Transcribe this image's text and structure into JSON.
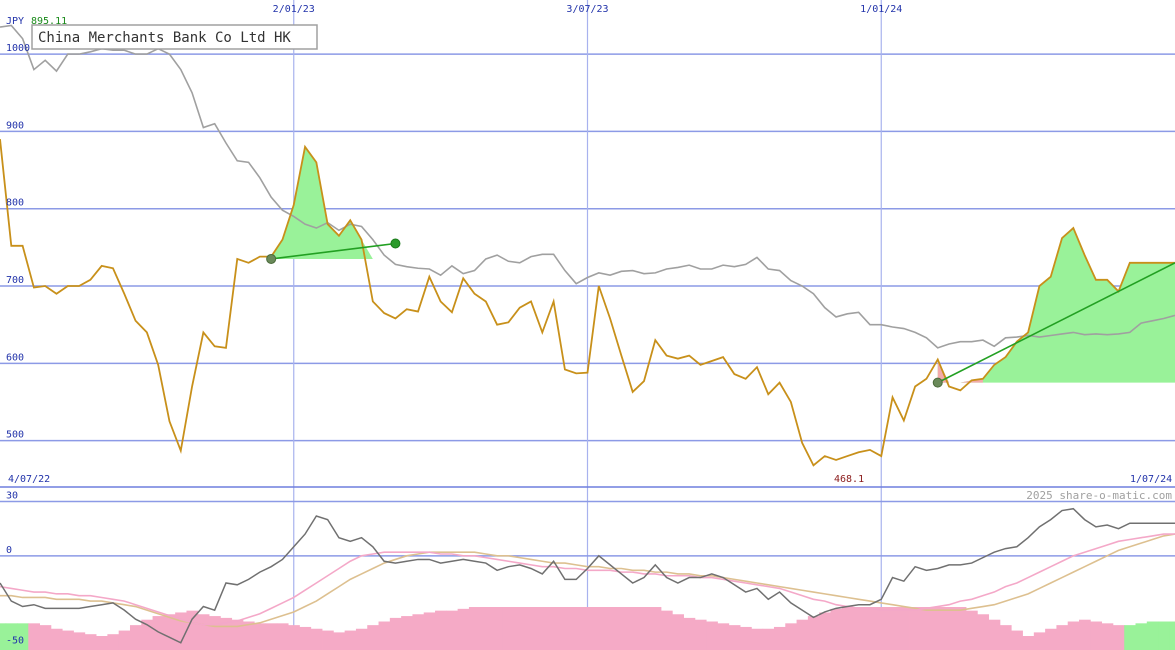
{
  "chart_data": [
    {
      "type": "line",
      "title": "China Merchants Bank Co Ltd HK",
      "currency_label": "JPY",
      "last_value_label": "895.11",
      "min_value_label": "468.1",
      "ylim": [
        440,
        1070
      ],
      "y_ticks": [
        1000,
        900,
        800,
        700,
        600,
        500
      ],
      "grid": true,
      "x_date_range": [
        "2022-07-04",
        "2024-07-01"
      ],
      "x_top_labels": [
        {
          "date": "2023-01-02",
          "label": "2/01/23"
        },
        {
          "date": "2023-07-03",
          "label": "3/07/23"
        },
        {
          "date": "2024-01-01",
          "label": "1/01/24"
        }
      ],
      "x_bottom_labels": {
        "start": "4/07/22",
        "end": "1/07/24"
      },
      "series": [
        {
          "name": "",
          "color": "#c8901a",
          "x": [
            "2022-07-04",
            "2022-07-11",
            "2022-07-18",
            "2022-07-25",
            "2022-08-01",
            "2022-08-08",
            "2022-08-15",
            "2022-08-22",
            "2022-08-29",
            "2022-09-05",
            "2022-09-12",
            "2022-09-19",
            "2022-09-26",
            "2022-10-03",
            "2022-10-10",
            "2022-10-17",
            "2022-10-24",
            "2022-10-31",
            "2022-11-07",
            "2022-11-14",
            "2022-11-21",
            "2022-11-28",
            "2022-12-05",
            "2022-12-12",
            "2022-12-19",
            "2022-12-26",
            "2023-01-02",
            "2023-01-09",
            "2023-01-16",
            "2023-01-23",
            "2023-01-30",
            "2023-02-06",
            "2023-02-13",
            "2023-02-20",
            "2023-02-27",
            "2023-03-06",
            "2023-03-13",
            "2023-03-20",
            "2023-03-27",
            "2023-04-03",
            "2023-04-10",
            "2023-04-17",
            "2023-04-24",
            "2023-05-01",
            "2023-05-08",
            "2023-05-15",
            "2023-05-22",
            "2023-05-29",
            "2023-06-05",
            "2023-06-12",
            "2023-06-19",
            "2023-06-26",
            "2023-07-03",
            "2023-07-10",
            "2023-07-17",
            "2023-07-24",
            "2023-07-31",
            "2023-08-07",
            "2023-08-14",
            "2023-08-21",
            "2023-08-28",
            "2023-09-04",
            "2023-09-11",
            "2023-09-18",
            "2023-09-25",
            "2023-10-02",
            "2023-10-09",
            "2023-10-16",
            "2023-10-23",
            "2023-10-30",
            "2023-11-06",
            "2023-11-13",
            "2023-11-20",
            "2023-11-27",
            "2023-12-04",
            "2023-12-11",
            "2023-12-18",
            "2023-12-25",
            "2024-01-01",
            "2024-01-08",
            "2024-01-15",
            "2024-01-22",
            "2024-01-29",
            "2024-02-05",
            "2024-02-12",
            "2024-02-19",
            "2024-02-26",
            "2024-03-04",
            "2024-03-11",
            "2024-03-18",
            "2024-03-25",
            "2024-04-01",
            "2024-04-08",
            "2024-04-15",
            "2024-04-22",
            "2024-04-29",
            "2024-05-06",
            "2024-05-13",
            "2024-05-20",
            "2024-05-27",
            "2024-06-03",
            "2024-06-10",
            "2024-06-17",
            "2024-06-24",
            "2024-07-01"
          ],
          "values": [
            890,
            752,
            752,
            698,
            700,
            690,
            700,
            700,
            708,
            726,
            723,
            690,
            655,
            640,
            598,
            525,
            487,
            570,
            640,
            622,
            620,
            735,
            730,
            738,
            738,
            760,
            805,
            880,
            860,
            780,
            765,
            785,
            760,
            680,
            665,
            658,
            670,
            667,
            712,
            680,
            666,
            710,
            690,
            680,
            650,
            653,
            672,
            680,
            640,
            680,
            592,
            587,
            588,
            700,
            658,
            610,
            563,
            577,
            630,
            610,
            606,
            610,
            598,
            603,
            608,
            586,
            580,
            595,
            560,
            575,
            550,
            497,
            468,
            480,
            475,
            480,
            485,
            488,
            480,
            556,
            526,
            570,
            580,
            605,
            570,
            565,
            578,
            580,
            598,
            608,
            628,
            640,
            700,
            712,
            762,
            775,
            740,
            708,
            708,
            693,
            730,
            730,
            730,
            730,
            730
          ]
        },
        {
          "name": "",
          "color": "#a0a0a0",
          "x": [
            "2022-07-04",
            "2022-07-11",
            "2022-07-18",
            "2022-07-25",
            "2022-08-01",
            "2022-08-08",
            "2022-08-15",
            "2022-08-22",
            "2022-08-29",
            "2022-09-05",
            "2022-09-12",
            "2022-09-19",
            "2022-09-26",
            "2022-10-03",
            "2022-10-10",
            "2022-10-17",
            "2022-10-24",
            "2022-10-31",
            "2022-11-07",
            "2022-11-14",
            "2022-11-21",
            "2022-11-28",
            "2022-12-05",
            "2022-12-12",
            "2022-12-19",
            "2022-12-26",
            "2023-01-02",
            "2023-01-09",
            "2023-01-16",
            "2023-01-23",
            "2023-01-30",
            "2023-02-06",
            "2023-02-13",
            "2023-02-20",
            "2023-02-27",
            "2023-03-06",
            "2023-03-13",
            "2023-03-20",
            "2023-03-27",
            "2023-04-03",
            "2023-04-10",
            "2023-04-17",
            "2023-04-24",
            "2023-05-01",
            "2023-05-08",
            "2023-05-15",
            "2023-05-22",
            "2023-05-29",
            "2023-06-05",
            "2023-06-12",
            "2023-06-19",
            "2023-06-26",
            "2023-07-03",
            "2023-07-10",
            "2023-07-17",
            "2023-07-24",
            "2023-07-31",
            "2023-08-07",
            "2023-08-14",
            "2023-08-21",
            "2023-08-28",
            "2023-09-04",
            "2023-09-11",
            "2023-09-18",
            "2023-09-25",
            "2023-10-02",
            "2023-10-09",
            "2023-10-16",
            "2023-10-23",
            "2023-10-30",
            "2023-11-06",
            "2023-11-13",
            "2023-11-20",
            "2023-11-27",
            "2023-12-04",
            "2023-12-11",
            "2023-12-18",
            "2023-12-25",
            "2024-01-01",
            "2024-01-08",
            "2024-01-15",
            "2024-01-22",
            "2024-01-29",
            "2024-02-05",
            "2024-02-12",
            "2024-02-19",
            "2024-02-26",
            "2024-03-04",
            "2024-03-11",
            "2024-03-18",
            "2024-03-25",
            "2024-04-01",
            "2024-04-08",
            "2024-04-15",
            "2024-04-22",
            "2024-04-29",
            "2024-05-06",
            "2024-05-13",
            "2024-05-20",
            "2024-05-27",
            "2024-06-03",
            "2024-06-10",
            "2024-06-17",
            "2024-06-24",
            "2024-07-01"
          ],
          "values": [
            1035,
            1037,
            1020,
            980,
            992,
            978,
            1000,
            1000,
            1003,
            1007,
            1005,
            1005,
            1000,
            1000,
            1007,
            1000,
            980,
            950,
            905,
            910,
            885,
            862,
            860,
            840,
            815,
            798,
            790,
            780,
            775,
            782,
            772,
            780,
            777,
            760,
            740,
            728,
            725,
            723,
            722,
            714,
            726,
            716,
            720,
            735,
            740,
            732,
            730,
            738,
            741,
            741,
            720,
            703,
            711,
            717,
            714,
            719,
            720,
            716,
            717,
            722,
            724,
            727,
            722,
            722,
            727,
            725,
            728,
            737,
            722,
            720,
            707,
            700,
            690,
            672,
            660,
            664,
            666,
            650,
            650,
            647,
            645,
            640,
            633,
            620,
            625,
            628,
            628,
            630,
            622,
            633,
            634,
            636,
            634,
            636,
            638,
            640,
            637,
            638,
            637,
            638,
            640,
            652,
            655,
            658,
            662
          ]
        }
      ],
      "highlight_regions": [
        {
          "color": "#99f299",
          "from": "2022-12-19",
          "to": "2023-03-06"
        },
        {
          "color": "#99f299",
          "from": "2024-02-05",
          "to": "2024-07-01"
        },
        {
          "color": "#f2aaaa",
          "from": "2024-02-05",
          "to": "2024-03-04"
        }
      ],
      "trend_lines": [
        {
          "color": "#22a022",
          "from": {
            "x": "2022-12-19",
            "y": 735
          },
          "to": {
            "x": "2023-03-06",
            "y": 755
          }
        },
        {
          "color": "#22a022",
          "from": {
            "x": "2024-02-05",
            "y": 575
          },
          "to": {
            "x": "2024-07-01",
            "y": 730
          }
        }
      ],
      "credit": "2025 share-o-matic.com"
    },
    {
      "type": "line",
      "ylim": [
        -52,
        38
      ],
      "y_ticks": [
        30,
        0,
        -50
      ],
      "grid": true,
      "series": [
        {
          "name": "",
          "color": "#707070",
          "values": [
            -15,
            -25,
            -28,
            -27,
            -29,
            -29,
            -29,
            -29,
            -28,
            -27,
            -26,
            -30,
            -35,
            -38,
            -42,
            -45,
            -48,
            -35,
            -28,
            -30,
            -15,
            -16,
            -13,
            -9,
            -6,
            -2,
            5,
            12,
            22,
            20,
            10,
            8,
            10,
            5,
            -3,
            -4,
            -3,
            -2,
            -2,
            -4,
            -3,
            -2,
            -3,
            -4,
            -8,
            -6,
            -5,
            -7,
            -10,
            -3,
            -13,
            -13,
            -7,
            0,
            -5,
            -10,
            -15,
            -12,
            -5,
            -12,
            -15,
            -12,
            -12,
            -10,
            -12,
            -16,
            -20,
            -18,
            -24,
            -20,
            -26,
            -30,
            -34,
            -31,
            -29,
            -28,
            -27,
            -27,
            -24,
            -12,
            -14,
            -6,
            -8,
            -7,
            -5,
            -5,
            -4,
            -1,
            2,
            4,
            5,
            10,
            16,
            20,
            25,
            26,
            20,
            16,
            17,
            15,
            18,
            18,
            18,
            18,
            18
          ]
        },
        {
          "name": "",
          "color": "#f4a8c8",
          "values": [
            -17,
            -18,
            -19,
            -20,
            -20,
            -21,
            -21,
            -22,
            -22,
            -23,
            -24,
            -25,
            -27,
            -29,
            -31,
            -33,
            -35,
            -37,
            -38,
            -38,
            -37,
            -36,
            -34,
            -32,
            -29,
            -26,
            -23,
            -19,
            -15,
            -11,
            -7,
            -3,
            0,
            1,
            2,
            2,
            2,
            2,
            2,
            1,
            1,
            0,
            0,
            -1,
            -2,
            -3,
            -4,
            -5,
            -6,
            -6,
            -7,
            -7,
            -8,
            -8,
            -8,
            -9,
            -9,
            -10,
            -10,
            -11,
            -11,
            -11,
            -12,
            -12,
            -13,
            -14,
            -15,
            -16,
            -17,
            -18,
            -20,
            -22,
            -24,
            -25,
            -27,
            -28,
            -29,
            -29,
            -30,
            -30,
            -30,
            -30,
            -29,
            -28,
            -27,
            -25,
            -24,
            -22,
            -20,
            -17,
            -15,
            -12,
            -9,
            -6,
            -3,
            0,
            2,
            4,
            6,
            8,
            9,
            10,
            11,
            12,
            12
          ]
        },
        {
          "name": "",
          "color": "#ddc090",
          "values": [
            -22,
            -22,
            -23,
            -23,
            -23,
            -24,
            -24,
            -24,
            -25,
            -25,
            -26,
            -27,
            -28,
            -30,
            -32,
            -34,
            -36,
            -37,
            -38,
            -39,
            -39,
            -39,
            -38,
            -37,
            -35,
            -33,
            -31,
            -28,
            -25,
            -21,
            -17,
            -13,
            -10,
            -7,
            -4,
            -2,
            0,
            1,
            2,
            2,
            2,
            2,
            2,
            1,
            0,
            0,
            -1,
            -2,
            -3,
            -4,
            -4,
            -5,
            -6,
            -6,
            -7,
            -7,
            -8,
            -8,
            -9,
            -9,
            -10,
            -10,
            -11,
            -11,
            -12,
            -13,
            -14,
            -15,
            -16,
            -17,
            -18,
            -19,
            -20,
            -21,
            -22,
            -23,
            -24,
            -25,
            -26,
            -27,
            -28,
            -29,
            -30,
            -30,
            -30,
            -30,
            -29,
            -28,
            -27,
            -25,
            -23,
            -21,
            -18,
            -15,
            -12,
            -9,
            -6,
            -3,
            0,
            3,
            5,
            7,
            9,
            11,
            12
          ]
        },
        {
          "name": "",
          "type": "bar",
          "color": "#f5aac6",
          "values": [
            -45,
            -45,
            -45,
            -45,
            -46,
            -48,
            -49,
            -50,
            -51,
            -52,
            -51,
            -49,
            -46,
            -43,
            -41,
            -40,
            -39,
            -38,
            -40,
            -41,
            -42,
            -43,
            -44,
            -45,
            -45,
            -45,
            -46,
            -47,
            -48,
            -49,
            -50,
            -49,
            -48,
            -46,
            -44,
            -42,
            -41,
            -40,
            -39,
            -38,
            -38,
            -37,
            -36,
            -35,
            -35,
            -34,
            -33,
            -32,
            -32,
            -31,
            -31,
            -30,
            -30,
            -31,
            -31,
            -32,
            -33,
            -34,
            -36,
            -38,
            -40,
            -42,
            -43,
            -44,
            -45,
            -46,
            -47,
            -48,
            -48,
            -47,
            -45,
            -43,
            -41,
            -39,
            -37,
            -35,
            -34,
            -33,
            -32,
            -32,
            -31,
            -31,
            -32,
            -33,
            -34,
            -36,
            -38,
            -40,
            -43,
            -46,
            -49,
            -52,
            -50,
            -48,
            -46,
            -44,
            -43,
            -44,
            -45,
            -46,
            -46,
            -45,
            -44,
            -44,
            -44
          ]
        }
      ],
      "bar_colors": {
        "negative": "#f5aac6",
        "low_green": "#99f299"
      },
      "green_bar_ranges": [
        [
          0,
          2
        ],
        [
          100,
          104
        ]
      ]
    }
  ]
}
